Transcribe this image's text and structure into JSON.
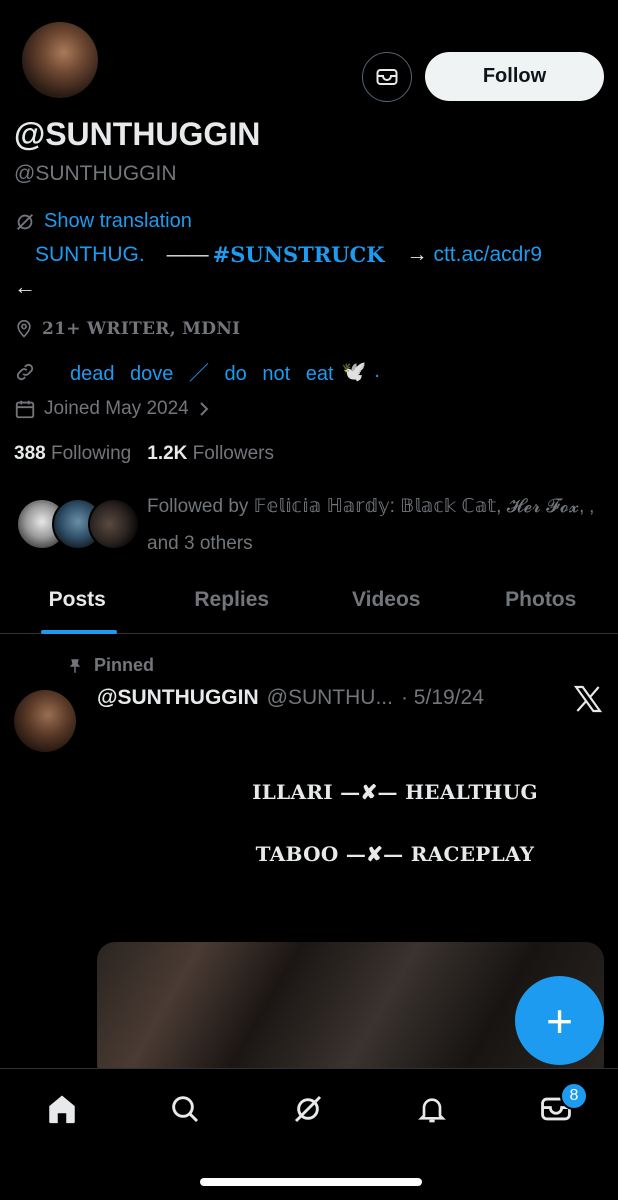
{
  "header": {
    "follow_label": "Follow",
    "message_icon": "envelope-icon"
  },
  "profile": {
    "display_name": "@SUNTHUGGIN",
    "handle": "@SUNTHUGGIN",
    "show_translation": "Show translation",
    "bio_prefix": "SUNTHUG.",
    "bio_dash": "——",
    "bio_hashtag": "#SUNSTRUCK",
    "bio_arrow": "→",
    "bio_link": "ctt.ac/acdr9",
    "bio_back_arrow": "←",
    "location": "21+ WRITER, MDNI",
    "website_text": "dead dove ／ do not eat",
    "website_emoji": "🕊️",
    "website_period": ".",
    "joined": "Joined May 2024",
    "following_count": "388",
    "following_label": "Following",
    "followers_count": "1.2K",
    "followers_label": "Followers",
    "followed_by": "Followed by 𝔽𝕖𝕝𝕚𝕔𝕚𝕒 ℍ𝕒𝕣𝕕𝕪: 𝔹𝕝𝕒𝕔𝕜 ℂ𝕒𝕥, 𝓗𝓮𝓻 𝓕𝓸𝔁, ‚ and 3 others"
  },
  "tabs": [
    {
      "label": "Posts",
      "active": true
    },
    {
      "label": "Replies",
      "active": false
    },
    {
      "label": "Videos",
      "active": false
    },
    {
      "label": "Photos",
      "active": false
    }
  ],
  "post": {
    "pinned_label": "Pinned",
    "author": "@SUNTHUGGIN",
    "handle": "@SUNTHU...",
    "date": "· 5/19/24",
    "line1": "ILLARI —✘— HEALTHUG",
    "line2": "TABOO —✘— RACEPLAY"
  },
  "compose": {
    "label": "+"
  },
  "bottom_nav": {
    "items": [
      "home-icon",
      "search-icon",
      "grok-icon",
      "notifications-icon",
      "messages-icon"
    ],
    "messages_badge": "8"
  },
  "colors": {
    "accent": "#1d9bf0",
    "background": "#000000",
    "text": "#e7e9ea",
    "secondary_text": "#71767b"
  }
}
